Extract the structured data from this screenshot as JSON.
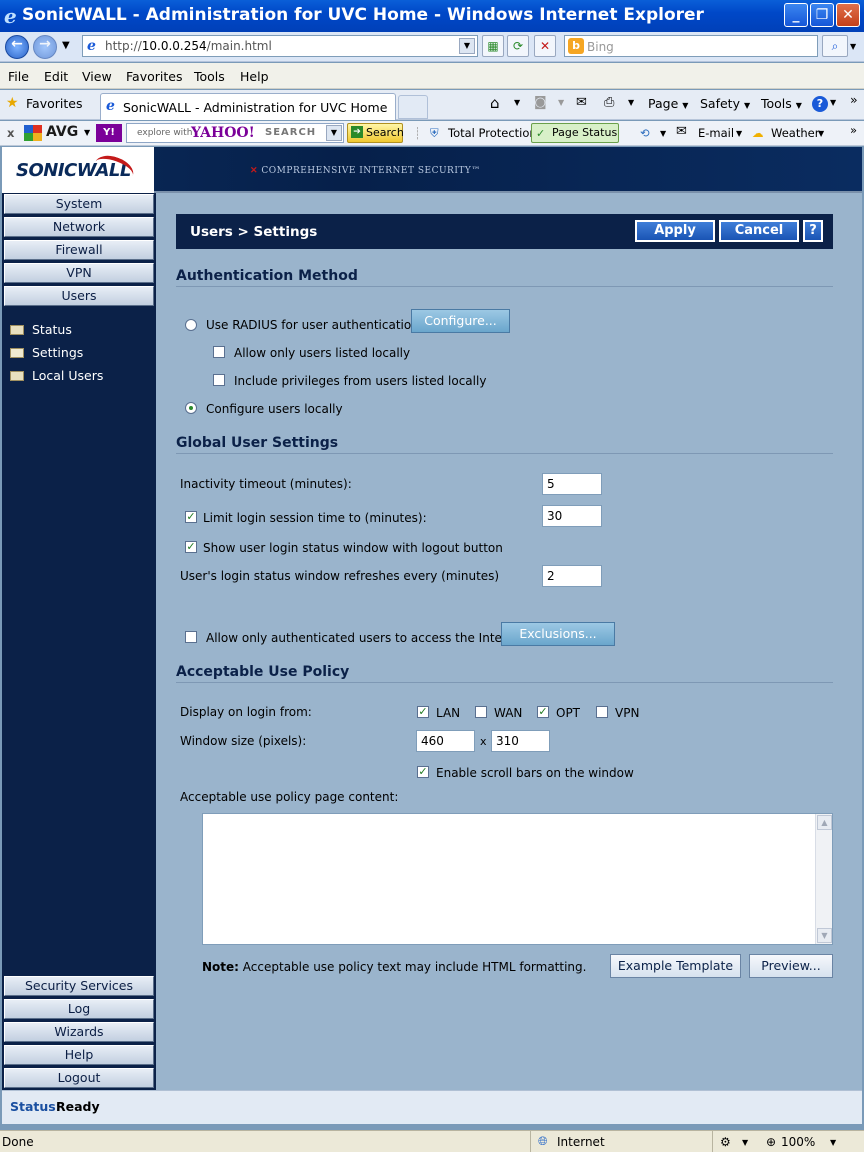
{
  "window": {
    "title": "SonicWALL - Administration for UVC Home - Windows Internet Explorer",
    "url_prefix": "http://",
    "url_host": "10.0.0.254",
    "url_path": "/main.html",
    "search_placeholder": "Bing"
  },
  "menu": [
    "File",
    "Edit",
    "View",
    "Favorites",
    "Tools",
    "Help"
  ],
  "favbar": {
    "favorites_label": "Favorites",
    "tab_title": "SonicWALL - Administration for UVC Home",
    "page_label": "Page",
    "safety_label": "Safety",
    "tools_label": "Tools"
  },
  "avgbar": {
    "close": "x",
    "avg_label": "AVG",
    "yahoo_placeholder": "explore with",
    "yahoo_brand": "YAHOO!",
    "yahoo_search": "SEARCH",
    "search_label": "Search",
    "total_protection": "Total Protection",
    "page_status": "Page Status",
    "email": "E-mail",
    "weather": "Weather"
  },
  "header": {
    "logo": "SONICWALL",
    "tagline_prefix": "✕",
    "tagline": "COMPREHENSIVE INTERNET SECURITY™"
  },
  "sidebar": {
    "top_items": [
      "System",
      "Network",
      "Firewall",
      "VPN",
      "Users"
    ],
    "sub_items": [
      "Status",
      "Settings",
      "Local Users"
    ],
    "bottom_items": [
      "Security Services",
      "Log",
      "Wizards",
      "Help",
      "Logout"
    ]
  },
  "content": {
    "title": "Users > Settings",
    "apply": "Apply",
    "cancel": "Cancel",
    "help": "?",
    "auth": {
      "heading": "Authentication Method",
      "radius_label": "Use RADIUS for user authentication",
      "configure_btn": "Configure...",
      "allow_local": "Allow only users listed locally",
      "include_privs": "Include privileges from users listed locally",
      "configure_local": "Configure users locally"
    },
    "global": {
      "heading": "Global User Settings",
      "inactivity_label": "Inactivity timeout (minutes):",
      "inactivity_value": "5",
      "limit_label": "Limit login session time to (minutes):",
      "limit_value": "30",
      "show_status_label": "Show user login status window with logout button",
      "refresh_label": "User's login status window refreshes every (minutes)",
      "refresh_value": "2",
      "allow_auth_label": "Allow only authenticated users to access the Internet",
      "exclusions_btn": "Exclusions..."
    },
    "aup": {
      "heading": "Acceptable Use Policy",
      "display_label": "Display on login from:",
      "zones": [
        {
          "name": "LAN",
          "checked": true
        },
        {
          "name": "WAN",
          "checked": false
        },
        {
          "name": "OPT",
          "checked": true
        },
        {
          "name": "VPN",
          "checked": false
        }
      ],
      "window_size_label": "Window size (pixels):",
      "width_value": "460",
      "x_sep": "x",
      "height_value": "310",
      "scrollbars_label": "Enable scroll bars on the window",
      "content_label": "Acceptable use policy page content:",
      "content_value": "",
      "note_bold": "Note:",
      "note_text": "Acceptable use policy text may include HTML formatting.",
      "example_btn": "Example Template",
      "preview_btn": "Preview..."
    }
  },
  "sw_status": {
    "label": "Status:",
    "value": "Ready"
  },
  "ie_status": {
    "left": "Done",
    "zone": "Internet",
    "zoom": "100%"
  },
  "colors": {
    "nav_dark": "#0b2148",
    "content_bg": "#9ab4cc",
    "button_blue": "#1a54b4"
  }
}
